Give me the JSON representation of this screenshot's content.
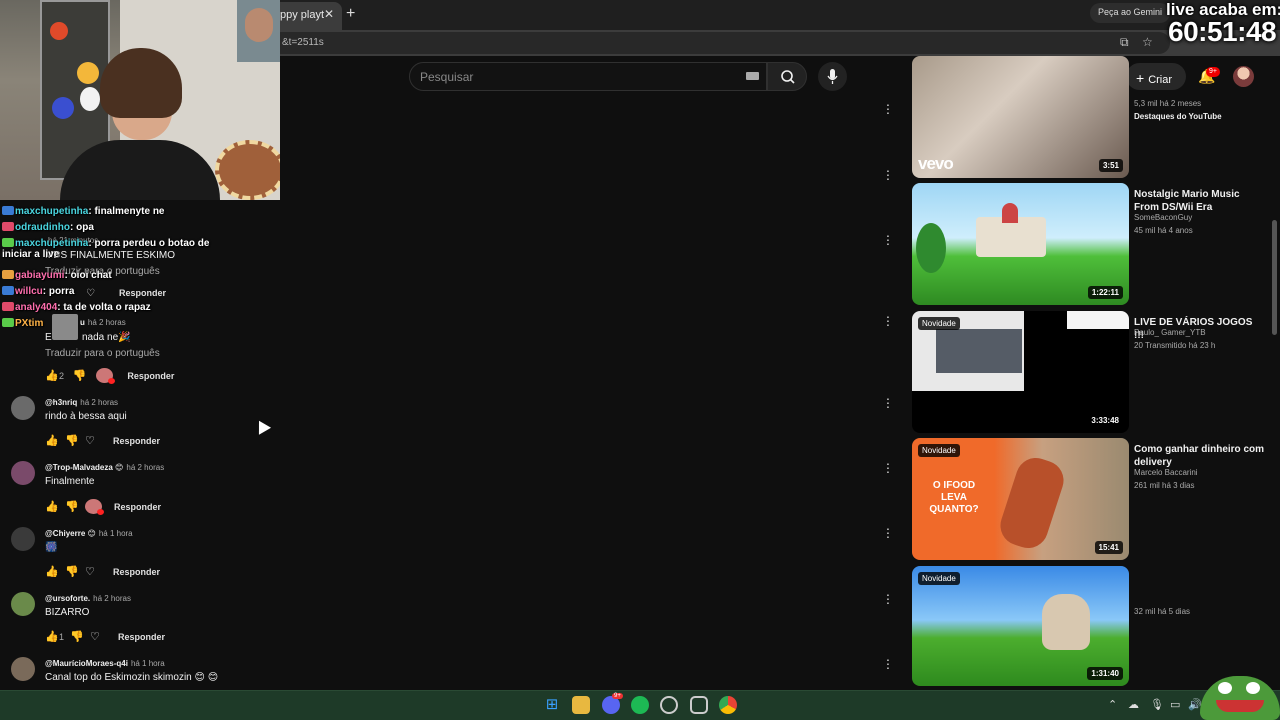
{
  "browser": {
    "tab_title": "ppy playt",
    "url": "&t=2511s",
    "gemini_label": "Peça ao Gemini"
  },
  "header": {
    "search_placeholder": "Pesquisar",
    "create_label": "Criar",
    "notification_badge": "9+"
  },
  "stream_overlay": {
    "timer_label": "live acaba em:",
    "timer_value": "60:51:48"
  },
  "chat": [
    {
      "user": "maxchupetinha",
      "text": "finalmenyte ne",
      "color": "#4ad6e0"
    },
    {
      "user": "odraudinho",
      "text": "opa",
      "color": "#4ad6e0"
    },
    {
      "user": "maxchupetinha",
      "text": "porra perdeu o botao de iniciar a live",
      "color": "#4ad6e0"
    },
    {
      "user": "gabiayumi",
      "text": "oioi chat",
      "color": "#ff6fae"
    },
    {
      "user": "willcu",
      "text": "porra",
      "color": "#ff6fae"
    },
    {
      "user": "analy404",
      "text": "ta de volta o rapaz",
      "color": "#ff6fae"
    },
    {
      "user": "PXtim",
      "text": "",
      "color": "#ffb347"
    }
  ],
  "comments": {
    "partial_top": {
      "time": "há 21 minutos",
      "text": "MDS FINALMENTE ESKIMO",
      "translate": "Traduzir para o português",
      "reply": "Responder"
    },
    "second": {
      "user_suffix": "u",
      "time": "há 2 horas",
      "text_start": "E",
      "text_end": "nada ne🎉",
      "translate": "Traduzir para o português",
      "likes": "2",
      "reply": "Responder"
    },
    "list": [
      {
        "user": "@h3nriq",
        "time": "há 2 horas",
        "text": "rindo à bessa aqui",
        "likes": "",
        "creator_heart": false,
        "reply": "Responder"
      },
      {
        "user": "@Trop-Malvadeza 😊",
        "time": "há 2 horas",
        "text": "Finalmente",
        "likes": "",
        "creator_heart": true,
        "reply": "Responder"
      },
      {
        "user": "@Chiyerre 😊",
        "time": "há 1 hora",
        "text": "🎆",
        "likes": "",
        "creator_heart": false,
        "reply": "Responder"
      },
      {
        "user": "@ursoforte.",
        "time": "há 2 horas",
        "text": "BIZARRO",
        "likes": "1",
        "creator_heart": false,
        "reply": "Responder"
      },
      {
        "user": "@MaurícioMoraes-q4i",
        "time": "há 1 hora",
        "text": "Canal top do Eskimozin skimozin 😊 😊",
        "likes": "",
        "creator_heart": false,
        "reply": "Responder"
      }
    ]
  },
  "sidebar": {
    "videos": [
      {
        "title": "",
        "channel": "Destaques do YouTube",
        "meta": "5,3 mil  há 2 meses",
        "duration": "3:51",
        "badge": "",
        "logo": "vevo"
      },
      {
        "title": "Nostalgic Mario Music From DS/Wii Era",
        "channel": "SomeBaconGuy",
        "meta": "45 mil  há 4 anos",
        "duration": "1:22:11",
        "badge": ""
      },
      {
        "title": "LIVE DE VÁRIOS JOGOS !!!",
        "channel": "Paulo_ Gamer_YTB",
        "meta": "20  Transmitido há 23 h",
        "duration": "3:33:48",
        "badge": "Novidade"
      },
      {
        "title": "Como ganhar dinheiro com delivery",
        "channel": "Marcelo Baccarini",
        "meta": "261 mil  há 3 dias",
        "duration": "15:41",
        "badge": "Novidade",
        "thumb_text": "O IFOOD LEVA QUANTO?"
      },
      {
        "title": "",
        "channel": "",
        "meta": "32 mil  há 5 dias",
        "duration": "1:31:40",
        "badge": "Novidade"
      }
    ]
  },
  "taskbar": {
    "discord_badge": "9+"
  }
}
